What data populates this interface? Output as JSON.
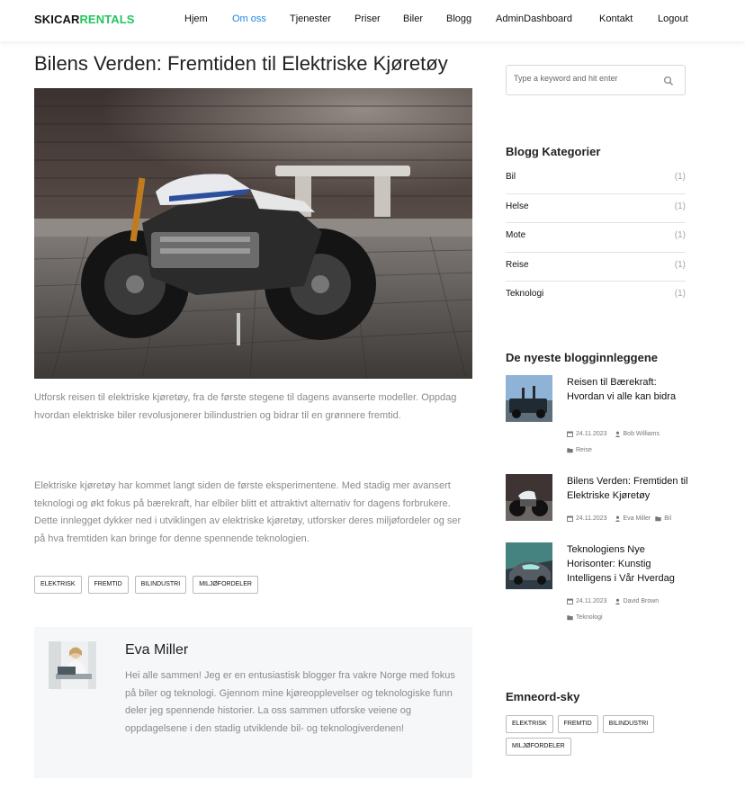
{
  "header": {
    "logo_part1": "SKICAR",
    "logo_part2": "RENTALS",
    "nav": [
      "Hjem",
      "Om oss",
      "Tjenester",
      "Priser",
      "Biler",
      "Blogg",
      "AdminDashboard",
      "Kontakt",
      "Logout"
    ],
    "active_nav": "Om oss"
  },
  "post": {
    "title": "Bilens Verden: Fremtiden til Elektriske Kjøretøy",
    "para1": "Utforsk reisen til elektriske kjøretøy, fra de første stegene til dagens avanserte modeller. Oppdag hvordan elektriske biler revolusjonerer bilindustrien og bidrar til en grønnere fremtid.",
    "para2": "Elektriske kjøretøy har kommet langt siden de første eksperimentene. Med stadig mer avansert teknologi og økt fokus på bærekraft, har elbiler blitt et attraktivt alternativ for dagens forbrukere. Dette innlegget dykker ned i utviklingen av elektriske kjøretøy, utforsker deres miljøfordeler og ser på hva fremtiden kan bringe for denne spennende teknologien.",
    "tags": [
      "ELEKTRISK",
      "FREMTID",
      "BILINDUSTRI",
      "MILJØFORDELER"
    ]
  },
  "author": {
    "name": "Eva Miller",
    "bio": "Hei alle sammen! Jeg er en entusiastisk blogger fra vakre Norge med fokus på biler og teknologi. Gjennom mine kjøreopplevelser og teknologiske funn deler jeg spennende historier. La oss sammen utforske veiene og oppdagelsene i den stadig utviklende bil- og teknologiverdenen!"
  },
  "sidebar": {
    "search_placeholder": "Type a keyword and hit enter",
    "categories_title": "Blogg Kategorier",
    "categories": [
      {
        "name": "Bil",
        "count": "(1)"
      },
      {
        "name": "Helse",
        "count": "(1)"
      },
      {
        "name": "Mote",
        "count": "(1)"
      },
      {
        "name": "Reise",
        "count": "(1)"
      },
      {
        "name": "Teknologi",
        "count": "(1)"
      }
    ],
    "recent_title": "De nyeste blogginnleggene",
    "recent": [
      {
        "title": "Reisen til Bærekraft: Hvordan vi alle kan bidra",
        "date": "24.11.2023",
        "author": "Bob Williams",
        "category": "Reise"
      },
      {
        "title": "Bilens Verden: Fremtiden til Elektriske Kjøretøy",
        "date": "24.11.2023",
        "author": "Eva Miller",
        "category": "Bil"
      },
      {
        "title": "Teknologiens Nye Horisonter: Kunstig Intelligens i Vår Hverdag",
        "date": "24.11.2023",
        "author": "David Brown",
        "category": "Teknologi"
      }
    ],
    "tagcloud_title": "Emneord-sky",
    "tagcloud": [
      "ELEKTRISK",
      "FREMTID",
      "BILINDUSTRI",
      "MILJØFORDELER"
    ]
  },
  "colors": {
    "logo_accent": "#22c55e",
    "nav_active": "#1e88e5",
    "body_text": "#8a8a8a",
    "author_box_bg": "#f6f7f9"
  },
  "icons": [
    "search-icon",
    "calendar-icon",
    "user-icon",
    "folder-icon"
  ]
}
